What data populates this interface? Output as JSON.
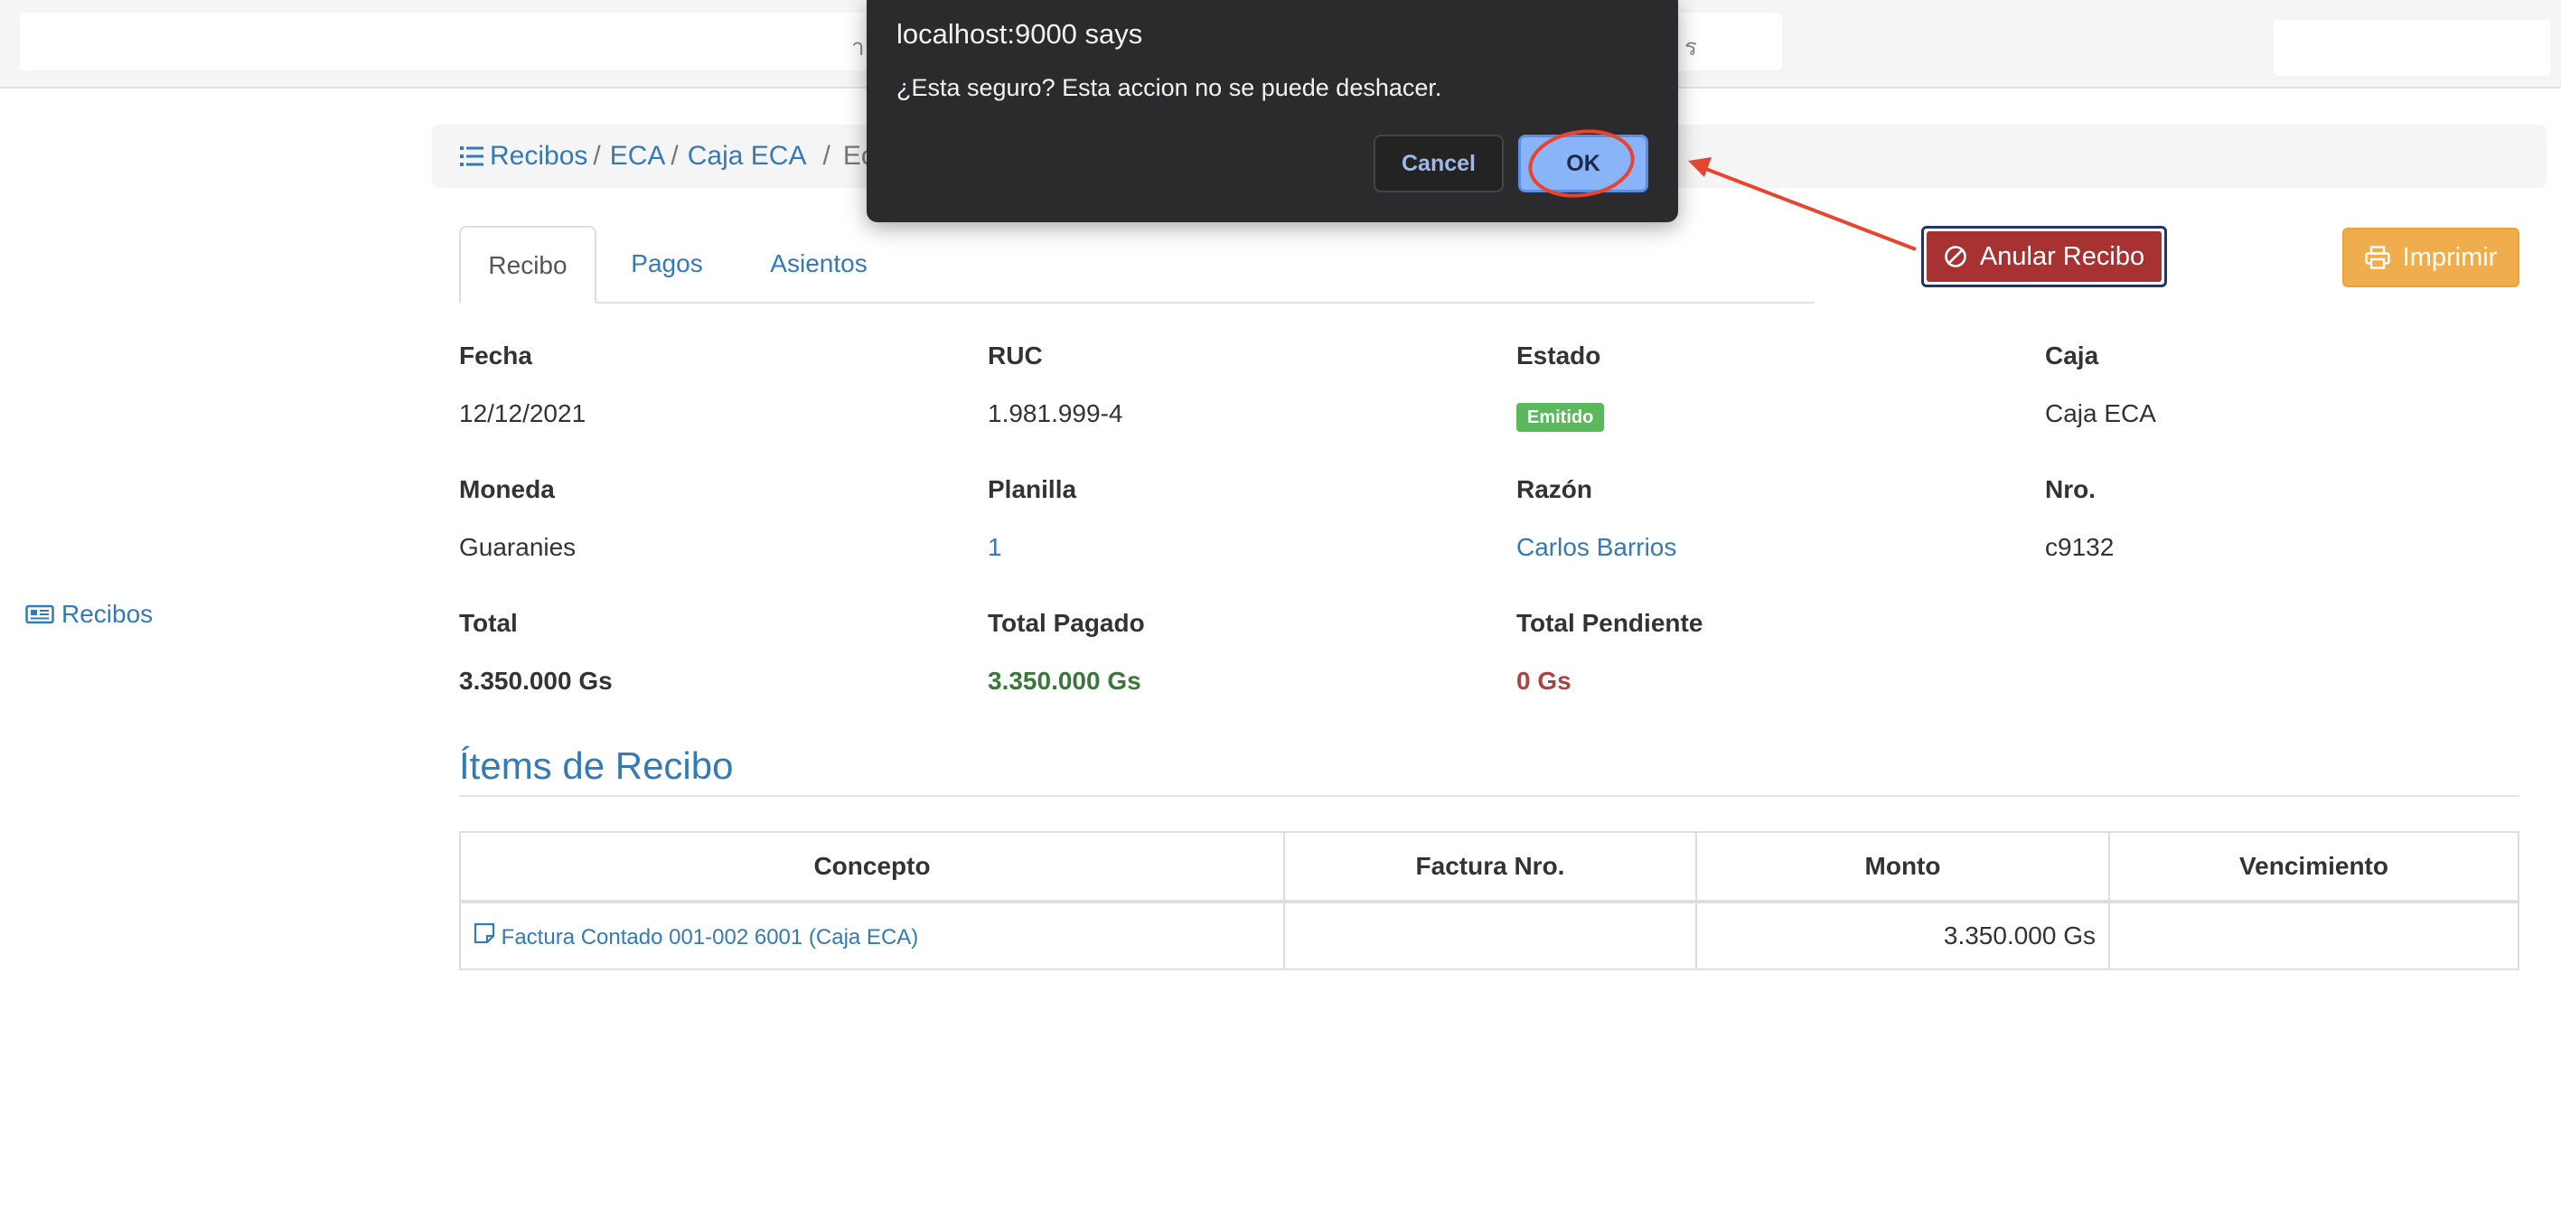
{
  "colors": {
    "link": "#337ab7",
    "danger_button": "#a83232",
    "warning_button": "#f0ad4e",
    "success_badge": "#5cb85c",
    "paid_green": "#3c763d",
    "pending_red": "#a94442",
    "dialog_bg": "#2b2b2d",
    "ok_button": "#8ab4f8",
    "annotation_red": "#e8452e"
  },
  "topbar": {
    "peek_left": "า",
    "peek_right": "ร"
  },
  "sidebar": {
    "items": [
      {
        "label": "Recibos",
        "icon": "newspaper-icon"
      }
    ]
  },
  "breadcrumb": {
    "items": [
      "Recibos",
      "ECA",
      "Caja ECA"
    ],
    "separator": "/",
    "current": "Ec",
    "icon": "list-icon"
  },
  "tabs": [
    {
      "label": "Recibo",
      "active": true
    },
    {
      "label": "Pagos",
      "active": false
    },
    {
      "label": "Asientos",
      "active": false
    }
  ],
  "actions": {
    "anular": {
      "label": "Anular Recibo",
      "icon": "ban-icon"
    },
    "imprimir": {
      "label": "Imprimir",
      "icon": "printer-icon"
    }
  },
  "details": {
    "fecha": {
      "label": "Fecha",
      "value": "12/12/2021"
    },
    "ruc": {
      "label": "RUC",
      "value": "1.981.999-4"
    },
    "estado": {
      "label": "Estado",
      "value": "Emitido"
    },
    "caja": {
      "label": "Caja",
      "value": "Caja ECA"
    },
    "moneda": {
      "label": "Moneda",
      "value": "Guaranies"
    },
    "planilla": {
      "label": "Planilla",
      "value": "1"
    },
    "razon": {
      "label": "Razón",
      "value": "Carlos Barrios"
    },
    "nro": {
      "label": "Nro.",
      "value": "c9132"
    },
    "total": {
      "label": "Total",
      "value": "3.350.000 Gs"
    },
    "total_pagado": {
      "label": "Total Pagado",
      "value": "3.350.000 Gs"
    },
    "total_pendiente": {
      "label": "Total Pendiente",
      "value": "0 Gs"
    }
  },
  "items_section": {
    "title": "Ítems de Recibo",
    "columns": [
      "Concepto",
      "Factura Nro.",
      "Monto",
      "Vencimiento"
    ],
    "rows": [
      {
        "concepto": "Factura Contado 001-002 6001 (Caja ECA)",
        "concepto_icon": "sticky-note-icon",
        "factura_nro": "",
        "monto": "3.350.000 Gs",
        "vencimiento": ""
      }
    ]
  },
  "dialog": {
    "title": "localhost:9000 says",
    "message": "¿Esta seguro? Esta accion no se puede deshacer.",
    "cancel_label": "Cancel",
    "ok_label": "OK"
  }
}
